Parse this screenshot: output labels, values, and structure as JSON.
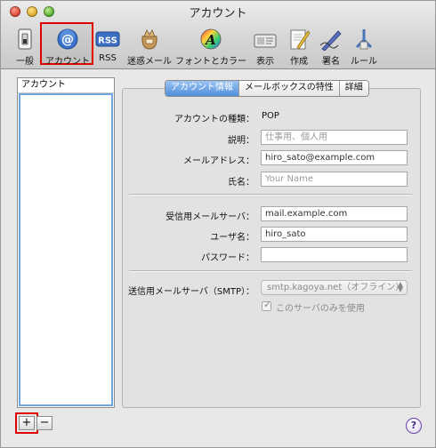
{
  "window": {
    "title": "アカウント"
  },
  "toolbar": {
    "items": [
      {
        "label": "一般",
        "icon": "switch-icon"
      },
      {
        "label": "アカウント",
        "icon": "at-sign-icon"
      },
      {
        "label": "RSS",
        "icon": "rss-icon"
      },
      {
        "label": "迷惑メール",
        "icon": "junk-mail-bag-icon"
      },
      {
        "label": "フォントとカラー",
        "icon": "font-color-icon"
      },
      {
        "label": "表示",
        "icon": "view-icon"
      },
      {
        "label": "作成",
        "icon": "compose-pencil-icon"
      },
      {
        "label": "署名",
        "icon": "signature-pen-icon"
      },
      {
        "label": "ルール",
        "icon": "rules-icon"
      }
    ],
    "rss_badge": "RSS",
    "font_glyph": "A"
  },
  "account_list": {
    "header": "アカウント"
  },
  "list_buttons": {
    "add": "+",
    "remove": "−"
  },
  "tabs": [
    "アカウント情報",
    "メールボックスの特性",
    "詳細"
  ],
  "form": {
    "account_type_label": "アカウントの種類：",
    "account_type_value": "POP",
    "description_label": "説明：",
    "description_placeholder": "仕事用、個人用",
    "email_label": "メールアドレス：",
    "email_value": "hiro_sato@example.com",
    "name_label": "氏名：",
    "name_placeholder": "Your Name",
    "incoming_label": "受信用メールサーバ：",
    "incoming_value": "mail.example.com",
    "username_label": "ユーザ名：",
    "username_value": "hiro_sato",
    "password_label": "パスワード：",
    "password_value": "",
    "outgoing_label": "送信用メールサーバ（SMTP）：",
    "outgoing_value": "smtp.kagoya.net（オフライン）",
    "only_this_server_label": "このサーバのみを使用"
  },
  "help": "?",
  "colors": {
    "selection_highlight": "#e00000",
    "tab_active": "#4f8fdc"
  }
}
